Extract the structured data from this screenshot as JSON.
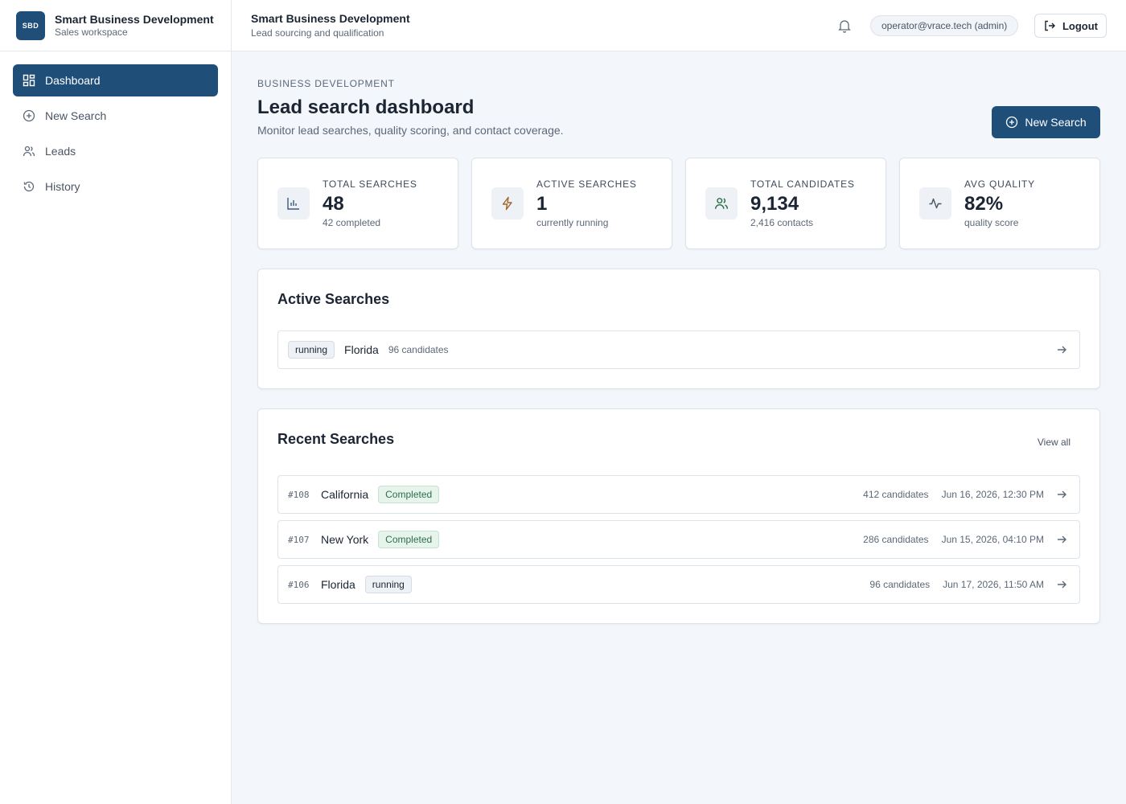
{
  "brand": {
    "logo": "SBD",
    "title": "Smart Business Development",
    "subtitle": "Sales workspace"
  },
  "nav": [
    {
      "label": "Dashboard",
      "icon": "dashboard-icon",
      "active": true
    },
    {
      "label": "New Search",
      "icon": "plus-circle-icon"
    },
    {
      "label": "Leads",
      "icon": "users-icon"
    },
    {
      "label": "History",
      "icon": "history-icon"
    }
  ],
  "header": {
    "title": "Smart Business Development",
    "subtitle": "Lead sourcing and qualification",
    "user": "operator@vrace.tech (admin)",
    "logout": "Logout"
  },
  "page": {
    "eyebrow": "BUSINESS DEVELOPMENT",
    "title": "Lead search dashboard",
    "description": "Monitor lead searches, quality scoring, and contact coverage.",
    "primary_button": "New Search"
  },
  "stats": [
    {
      "label": "TOTAL SEARCHES",
      "value": "48",
      "sub": "42 completed",
      "icon": "bar-chart-icon",
      "color": "#3a5a80"
    },
    {
      "label": "ACTIVE SEARCHES",
      "value": "1",
      "sub": "currently running",
      "icon": "bolt-icon",
      "color": "#a0652a"
    },
    {
      "label": "TOTAL CANDIDATES",
      "value": "9,134",
      "sub": "2,416 contacts",
      "icon": "users-icon",
      "color": "#2f6e4b"
    },
    {
      "label": "AVG QUALITY",
      "value": "82%",
      "sub": "quality score",
      "icon": "activity-icon",
      "color": "#4a5565"
    }
  ],
  "active": {
    "title": "Active Searches",
    "rows": [
      {
        "status": "running",
        "name": "Florida",
        "count": "96 candidates"
      }
    ]
  },
  "recent": {
    "title": "Recent Searches",
    "view_all": "View all",
    "rows": [
      {
        "id": "#108",
        "name": "California",
        "status": "Completed",
        "count": "412 candidates",
        "date": "Jun 16, 2026, 12:30 PM"
      },
      {
        "id": "#107",
        "name": "New York",
        "status": "Completed",
        "count": "286 candidates",
        "date": "Jun 15, 2026, 04:10 PM"
      },
      {
        "id": "#106",
        "name": "Florida",
        "status": "running",
        "count": "96 candidates",
        "date": "Jun 17, 2026, 11:50 AM"
      }
    ]
  },
  "colors": {
    "primary": "#1f4e79",
    "completed_bg": "#e6f4ec",
    "completed_text": "#2f6e4b"
  }
}
